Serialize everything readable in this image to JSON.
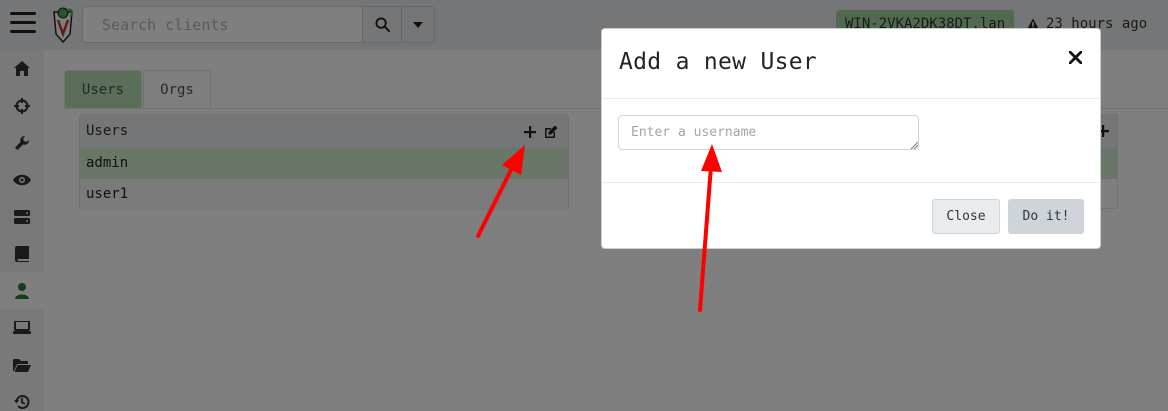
{
  "topbar": {
    "search_placeholder": "Search clients",
    "host_name": "WIN-2VKA2DK38DT.lan",
    "last_seen": "23 hours ago",
    "icons": [
      "hamburger-icon",
      "logo-icon",
      "search-icon",
      "caret-down-icon",
      "warning-icon"
    ]
  },
  "sidebar": {
    "items": [
      {
        "icon": "home-icon"
      },
      {
        "icon": "crosshair-icon"
      },
      {
        "icon": "wrench-icon"
      },
      {
        "icon": "eye-icon"
      },
      {
        "icon": "server-icon"
      },
      {
        "icon": "book-icon"
      },
      {
        "icon": "user-icon",
        "active": true
      },
      {
        "icon": "laptop-icon"
      },
      {
        "icon": "folder-open-icon"
      },
      {
        "icon": "history-icon"
      }
    ]
  },
  "tabs": [
    {
      "label": "Users",
      "active": true
    },
    {
      "label": "Orgs",
      "active": false
    }
  ],
  "users_panel": {
    "header": "Users",
    "rows": [
      {
        "name": "admin",
        "selected": true
      },
      {
        "name": "user1",
        "selected": false
      }
    ]
  },
  "modal": {
    "title": "Add a new User",
    "username_placeholder": "Enter a username",
    "username_value": "",
    "close_button": "Close",
    "submit_button": "Do it!"
  },
  "colors": {
    "accent_green": "#a3d39c",
    "selected_row": "#d4ecce",
    "annotation_arrow": "#ff0000"
  }
}
